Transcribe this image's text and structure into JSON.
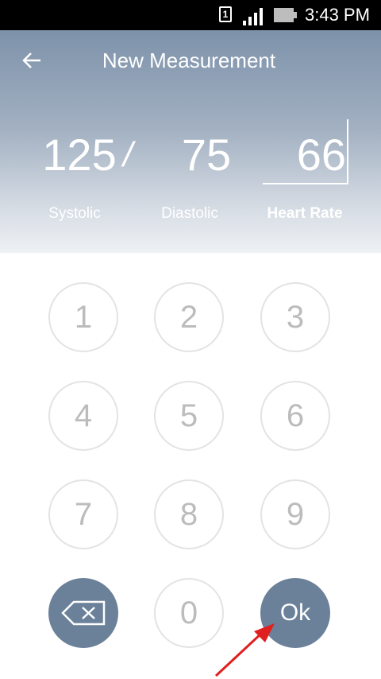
{
  "status_bar": {
    "sim_label": "1",
    "time": "3:43 PM"
  },
  "header": {
    "title": "New Measurement",
    "back_icon": "arrow-left-icon"
  },
  "readings": {
    "systolic": "125",
    "separator": "/",
    "diastolic": "75",
    "heart_rate": "66"
  },
  "labels": {
    "systolic": "Systolic",
    "diastolic": "Diastolic",
    "heart_rate": "Heart Rate"
  },
  "keypad": {
    "keys": [
      "1",
      "2",
      "3",
      "4",
      "5",
      "6",
      "7",
      "8",
      "9"
    ],
    "zero": "0",
    "ok": "Ok",
    "backspace_icon": "backspace-icon"
  },
  "colors": {
    "accent": "#6b8099",
    "key_border": "#e3e3e3",
    "key_text": "#bcbcbc",
    "arrow": "#e02020"
  }
}
